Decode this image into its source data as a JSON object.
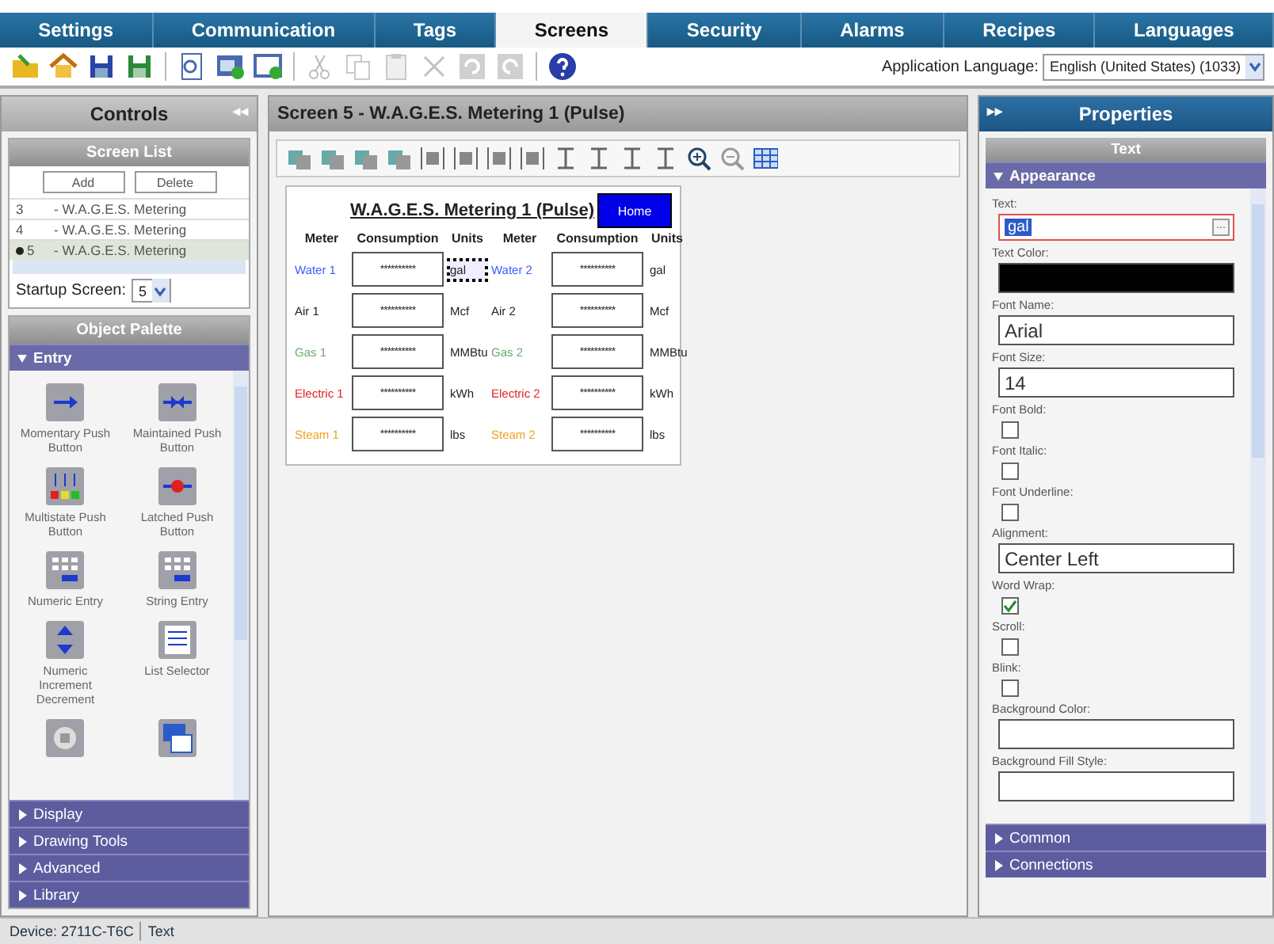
{
  "tabs": [
    {
      "label": "Settings",
      "selected": false
    },
    {
      "label": "Communication",
      "selected": false
    },
    {
      "label": "Tags",
      "selected": false
    },
    {
      "label": "Screens",
      "selected": true
    },
    {
      "label": "Security",
      "selected": false
    },
    {
      "label": "Alarms",
      "selected": false
    },
    {
      "label": "Recipes",
      "selected": false
    },
    {
      "label": "Languages",
      "selected": false
    }
  ],
  "toolbar": [
    {
      "kind": "folder",
      "disabled": false
    },
    {
      "kind": "home",
      "disabled": false
    },
    {
      "kind": "save",
      "disabled": false
    },
    {
      "kind": "save-all",
      "disabled": false
    },
    {
      "kind": "find",
      "disabled": false
    },
    {
      "kind": "screen-check",
      "disabled": false
    },
    {
      "kind": "screen-ok",
      "disabled": false
    },
    {
      "kind": "cut",
      "disabled": true
    },
    {
      "kind": "copy",
      "disabled": true
    },
    {
      "kind": "paste",
      "disabled": true
    },
    {
      "kind": "delete",
      "disabled": true
    },
    {
      "kind": "undo",
      "disabled": true
    },
    {
      "kind": "redo",
      "disabled": true
    },
    {
      "kind": "help",
      "disabled": false
    }
  ],
  "app_language": {
    "label": "Application Language:",
    "value": "English (United States) (1033)"
  },
  "controls": {
    "title": "Controls",
    "collapse": "◂◂",
    "screen_list": {
      "title": "Screen List",
      "buttons": [
        "Add",
        "Delete"
      ],
      "rows": [
        {
          "number": "3",
          "name": "- W.A.G.E.S. Metering",
          "selected": false,
          "startup": false
        },
        {
          "number": "4",
          "name": "- W.A.G.E.S. Metering",
          "selected": false,
          "startup": false
        },
        {
          "number": "5",
          "name": "- W.A.G.E.S. Metering",
          "selected": true,
          "startup": true
        }
      ],
      "startup_label": "Startup Screen:",
      "startup_value": "5"
    },
    "palette": {
      "title": "Object Palette",
      "sections": [
        {
          "label": "Entry",
          "expanded": true,
          "items": [
            {
              "kind": "momentary",
              "label": "Momentary Push Button"
            },
            {
              "kind": "maintained",
              "label": "Maintained Push Button"
            },
            {
              "kind": "multistate",
              "label": "Multistate Push Button"
            },
            {
              "kind": "latched",
              "label": "Latched Push Button"
            },
            {
              "kind": "keypad",
              "label": "Numeric Entry"
            },
            {
              "kind": "keypad",
              "label": "String Entry"
            },
            {
              "kind": "updown",
              "label": "Numeric Increment Decrement"
            },
            {
              "kind": "list",
              "label": "List Selector"
            },
            {
              "kind": "dpad"
            },
            {
              "kind": "windows"
            }
          ]
        },
        {
          "label": "Display",
          "expanded": false
        },
        {
          "label": "Drawing Tools",
          "expanded": false
        },
        {
          "label": "Advanced",
          "expanded": false
        },
        {
          "label": "Library",
          "expanded": false
        }
      ]
    }
  },
  "editor": {
    "title": "Screen 5 - W.A.G.E.S. Metering 1 (Pulse)",
    "screen": {
      "heading": "W.A.G.E.S. Metering 1 (Pulse)",
      "home_button": "Home",
      "headings": [
        "Meter",
        "Consumption",
        "Units",
        "Meter",
        "Consumption",
        "Units"
      ],
      "meters": [
        {
          "meter": "Water 1",
          "color": "#3b5bff",
          "value": "**********",
          "units": "gal",
          "selected": true
        },
        {
          "meter": "Water 2",
          "color": "#3b5bff",
          "value": "**********",
          "units": "gal",
          "selected": false
        },
        {
          "meter": "Air 1",
          "color": "#222222",
          "value": "**********",
          "units": "Mcf",
          "selected": false
        },
        {
          "meter": "Air 2",
          "color": "#222222",
          "value": "**********",
          "units": "Mcf",
          "selected": false
        },
        {
          "meter": "Gas 1",
          "color": "#6aaa6a",
          "value": "**********",
          "units": "MMBtu",
          "selected": false
        },
        {
          "meter": "Gas 2",
          "color": "#6aaa6a",
          "value": "**********",
          "units": "MMBtu",
          "selected": false
        },
        {
          "meter": "Electric 1",
          "color": "#e82020",
          "value": "**********",
          "units": "kWh",
          "selected": false
        },
        {
          "meter": "Electric 2",
          "color": "#e82020",
          "value": "**********",
          "units": "kWh",
          "selected": false
        },
        {
          "meter": "Steam 1",
          "color": "#f0a020",
          "value": "**********",
          "units": "lbs",
          "selected": false
        },
        {
          "meter": "Steam 2",
          "color": "#f0a020",
          "value": "**********",
          "units": "lbs",
          "selected": false
        }
      ]
    }
  },
  "properties": {
    "title": "Properties",
    "expand": "▸▸",
    "object": "Text",
    "section": "Appearance",
    "fields": [
      {
        "kind": "text",
        "label": "Text:",
        "value": "gal",
        "focused": true,
        "browse": "..."
      },
      {
        "kind": "color",
        "label": "Text Color:",
        "color": "#000000"
      },
      {
        "kind": "text",
        "label": "Font Name:",
        "value": "Arial",
        "focused": false
      },
      {
        "kind": "text",
        "label": "Font Size:",
        "value": "14",
        "focused": false
      },
      {
        "kind": "checkbox",
        "label": "Font Bold:",
        "checked": false
      },
      {
        "kind": "checkbox",
        "label": "Font Italic:",
        "checked": false
      },
      {
        "kind": "checkbox",
        "label": "Font Underline:",
        "checked": false
      },
      {
        "kind": "text",
        "label": "Alignment:",
        "value": "Center Left",
        "focused": false
      },
      {
        "kind": "checkbox",
        "label": "Word Wrap:",
        "checked": true
      },
      {
        "kind": "checkbox",
        "label": "Scroll:",
        "checked": false
      },
      {
        "kind": "checkbox",
        "label": "Blink:",
        "checked": false
      },
      {
        "kind": "color",
        "label": "Background Color:",
        "color": "#ffffff"
      },
      {
        "kind": "text",
        "label": "Background Fill Style:",
        "focused": false
      }
    ],
    "sections": [
      {
        "label": "Common",
        "expanded": false
      },
      {
        "label": "Connections",
        "expanded": false
      }
    ]
  },
  "status_bar": {
    "device": "Device: 2711C-T6C",
    "selection": "Text"
  }
}
